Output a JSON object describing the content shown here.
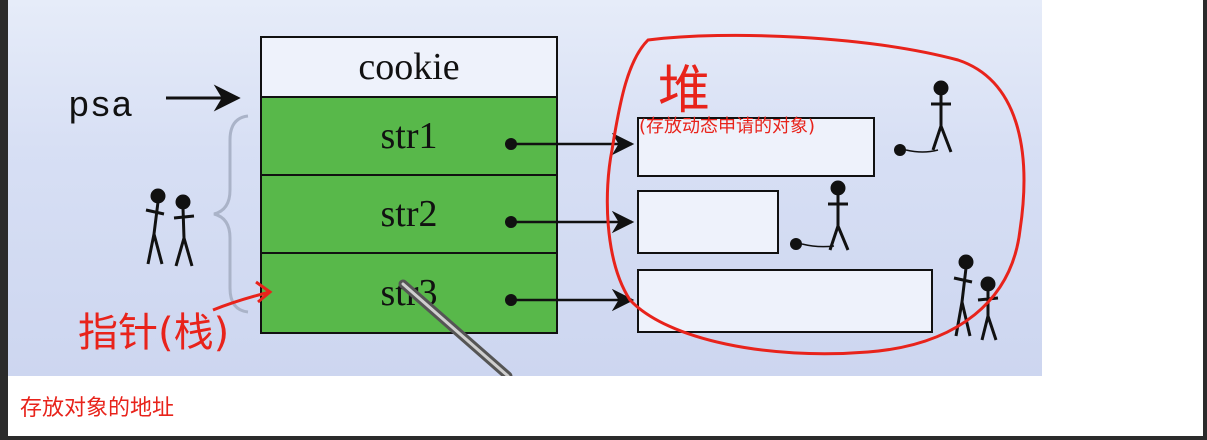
{
  "diagram": {
    "pointer_var": "psa",
    "struct_fields": [
      "cookie",
      "str1",
      "str2",
      "str3"
    ],
    "annotation_heap_title": "堆",
    "annotation_heap_note": "(存放动态申请的对象)",
    "annotation_stack": "指针(栈)"
  },
  "caption": "存放对象的地址",
  "colors": {
    "field_green": "#58b84a",
    "annotation_red": "#e8231b",
    "slide_bg": "#d7dff4"
  }
}
